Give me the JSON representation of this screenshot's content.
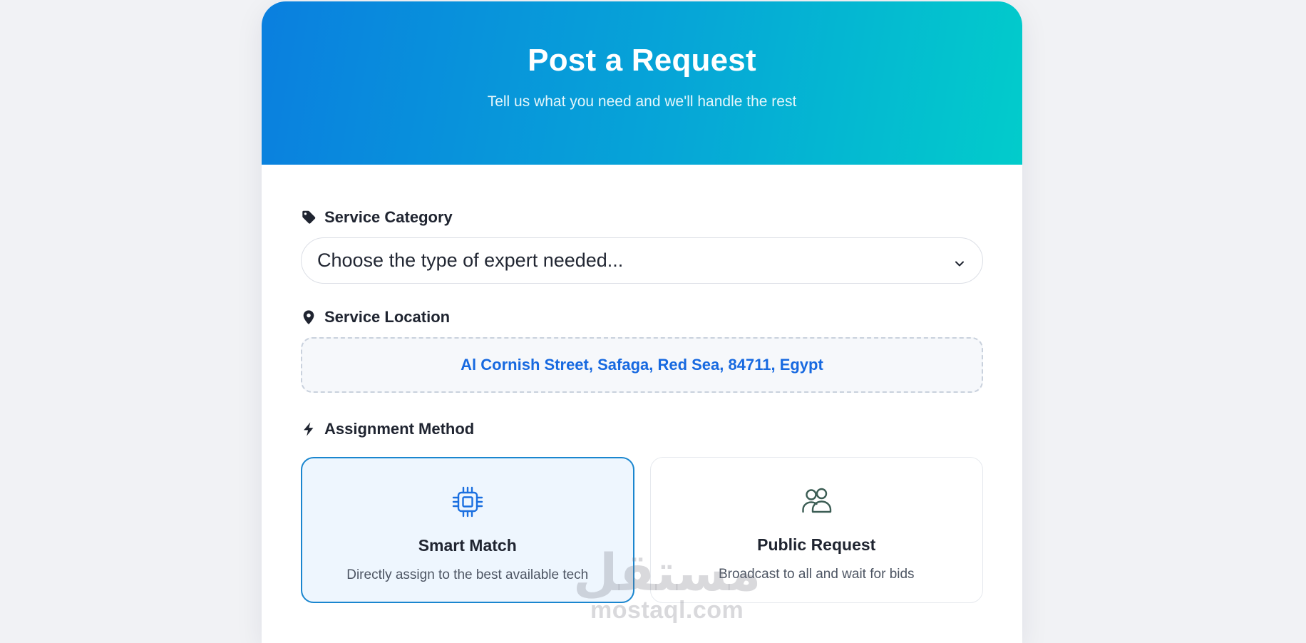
{
  "header": {
    "title": "Post a Request",
    "subtitle": "Tell us what you need and we'll handle the rest"
  },
  "form": {
    "category": {
      "label": "Service Category",
      "icon": "tag-icon",
      "selected_value": "Choose the type of expert needed..."
    },
    "location": {
      "label": "Service Location",
      "icon": "map-pin-icon",
      "value": "Al Cornish Street, Safaga, Red Sea, 84711, Egypt"
    },
    "assignment": {
      "label": "Assignment Method",
      "icon": "lightning-icon",
      "options": [
        {
          "title": "Smart Match",
          "description": "Directly assign to the best available tech",
          "icon": "cpu-chip-icon",
          "selected": true
        },
        {
          "title": "Public Request",
          "description": "Broadcast to all and wait for bids",
          "icon": "users-icon",
          "selected": false
        }
      ]
    }
  },
  "watermark": {
    "arabic": "مستقل",
    "latin": "mostaql.com"
  },
  "colors": {
    "gradient_start": "#0a7fdf",
    "gradient_end": "#02cccb",
    "accent_blue": "#1769e0",
    "selected_border": "#1a86cf",
    "selected_bg": "#eef6fe",
    "page_bg": "#f1f2f5"
  }
}
